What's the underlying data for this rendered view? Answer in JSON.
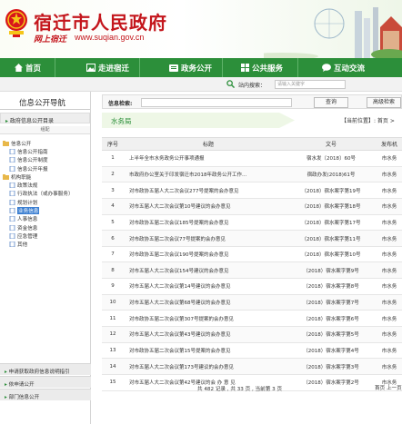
{
  "header": {
    "site_title": "宿迁市人民政府",
    "slogan": "网上宿迁",
    "url": "www.suqian.gov.cn"
  },
  "nav": [
    {
      "label": "首页",
      "icon": "home-icon"
    },
    {
      "label": "走进宿迁",
      "icon": "image-icon"
    },
    {
      "label": "政务公开",
      "icon": "folder-icon"
    },
    {
      "label": "公共服务",
      "icon": "grid-icon"
    },
    {
      "label": "互动交流",
      "icon": "chat-icon"
    }
  ],
  "site_search": {
    "label": "站内搜索：",
    "placeholder": "请输入关键字"
  },
  "sidebar": {
    "title": "信息公开导航",
    "section": "政府信息公开目录",
    "fold": "组配",
    "tree": [
      {
        "label": "信息公开",
        "level": 1,
        "icon": "folder-icon"
      },
      {
        "label": "信息公开指南",
        "level": 2,
        "icon": "doc-icon"
      },
      {
        "label": "信息公开制度",
        "level": 2,
        "icon": "doc-icon"
      },
      {
        "label": "信息公开年报",
        "level": 2,
        "icon": "doc-icon"
      },
      {
        "label": "机构职能",
        "level": 1,
        "icon": "folder-icon"
      },
      {
        "label": "政策法规",
        "level": 2,
        "icon": "doc-icon"
      },
      {
        "label": "行政执法（或办事服务）",
        "level": 2,
        "icon": "doc-icon"
      },
      {
        "label": "规划计划",
        "level": 2,
        "icon": "doc-icon"
      },
      {
        "label": "业务信息",
        "level": 2,
        "icon": "doc-icon",
        "selected": true
      },
      {
        "label": "人事信息",
        "level": 2,
        "icon": "doc-icon"
      },
      {
        "label": "资金信息",
        "level": 2,
        "icon": "doc-icon"
      },
      {
        "label": "应急管理",
        "level": 2,
        "icon": "doc-icon"
      },
      {
        "label": "其他",
        "level": 2,
        "icon": "doc-icon"
      }
    ],
    "bottom_items": [
      "申请获取政府信息说明指引",
      "依申请公开",
      "部门信息公开"
    ]
  },
  "info_search": {
    "label": "信息检索:",
    "query_button": "查询",
    "advanced_button": "高级检索"
  },
  "tab_title": "水务局",
  "breadcrumb": "【当前位置】: 首页 >",
  "table": {
    "headers": [
      "序号",
      "标题",
      "文号",
      "发布机"
    ],
    "rows": [
      [
        "1",
        "上半年全市水务政务公开事项通报",
        "宿水发〔2018〕60号",
        "市水务"
      ],
      [
        "2",
        "市政府办公室关于印发宿迁市2018年政务公开工作...",
        "宿政办发(2018)61号",
        "市水务"
      ],
      [
        "3",
        "对市政协五届人大二次会议277号提案的会办意见",
        "（2018）宿水案字第19号",
        "市水务"
      ],
      [
        "4",
        "对市五届人大二次会议第10号建议的会办意见",
        "（2018）宿水案字第18号",
        "市水务"
      ],
      [
        "5",
        "对市政协五届二次会议185号提案的会办意见",
        "（2018）宿水案字第17号",
        "市水务"
      ],
      [
        "6",
        "对市政协五届二次会议77号提案的会办意见",
        "（2018）宿水案字第11号",
        "市水务"
      ],
      [
        "7",
        "对市政协五届二次会议190号提案的会办意见",
        "（2018）宿水案字第10号",
        "市水务"
      ],
      [
        "8",
        "对市五届人大二次会议154号建议的会办意见",
        "（2018）宿水案字第9号",
        "市水务"
      ],
      [
        "9",
        "对市五届人大二次会议第14号建议的会办意见",
        "（2018）宿水案字第8号",
        "市水务"
      ],
      [
        "10",
        "对市五届人大二次会议第68号建议的会办意见",
        "（2018）宿水案字第7号",
        "市水务"
      ],
      [
        "11",
        "对市政协五届二次会议第307号提案的会办意见",
        "（2018）宿水案字第6号",
        "市水务"
      ],
      [
        "12",
        "对市五届人大二次会议第43号建议的会办意见",
        "（2018）宿水案字第5号",
        "市水务"
      ],
      [
        "13",
        "对市政协五届二次会议第15号提案的会办意见",
        "（2018）宿水案字第4号",
        "市水务"
      ],
      [
        "14",
        "对市五届人大二次会议第173号建议的会办意见",
        "（2018）宿水案字第3号",
        "市水务"
      ],
      [
        "15",
        "对市五届人大二次会议第42号建议的会 办 意 见",
        "（2018）宿水案字第2号",
        "市水务"
      ]
    ]
  },
  "pager": {
    "info": "共 482 记录 , 共 33 页 , 当前第 3 页",
    "nav": "首页 上一页"
  },
  "colors": {
    "brand_red": "#c4161c",
    "nav_green": "#2c8f3a",
    "selected_blue": "#3c7fd1"
  }
}
